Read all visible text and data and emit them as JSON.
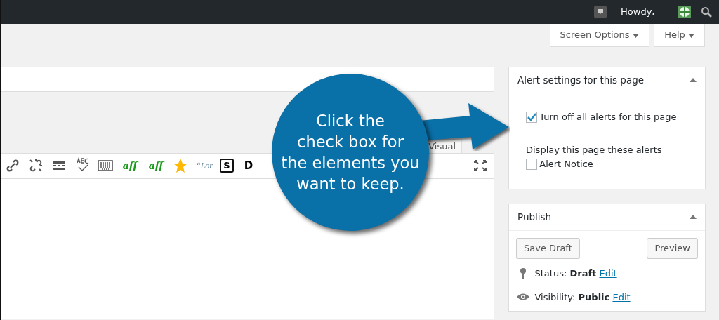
{
  "admin_bar": {
    "greeting": "Howdy,"
  },
  "header_buttons": [
    {
      "label": "Screen Options"
    },
    {
      "label": "Help"
    }
  ],
  "editor": {
    "tabs": [
      {
        "label": "Visual",
        "selected": true
      }
    ],
    "toolbar": [
      {
        "kind": "link"
      },
      {
        "kind": "unlink"
      },
      {
        "kind": "more"
      },
      {
        "kind": "spellcheck"
      },
      {
        "kind": "keyboard"
      },
      {
        "kind": "aff",
        "label": "aff"
      },
      {
        "kind": "aff-plus",
        "label": "aff"
      },
      {
        "kind": "star"
      },
      {
        "kind": "quote",
        "label": "“Lor"
      },
      {
        "kind": "boxed",
        "label": "S"
      },
      {
        "kind": "plain",
        "label": "D"
      }
    ]
  },
  "alert_box": {
    "title": "Alert settings for this page",
    "expanded": true,
    "options": [
      {
        "label": "Turn off all alerts for this page",
        "checked": true
      }
    ],
    "group_label": "Display this page these alerts",
    "alerts": [
      {
        "label": "Alert Notice",
        "checked": false
      }
    ]
  },
  "publish_box": {
    "title": "Publish",
    "expanded": true,
    "buttons": [
      {
        "label": "Save Draft"
      },
      {
        "label": "Preview"
      }
    ],
    "rows": [
      {
        "kind": "pin",
        "label": "Status:",
        "value": "Draft",
        "link": "Edit"
      },
      {
        "kind": "eye",
        "label": "Visibility:",
        "value": "Public",
        "link": "Edit"
      }
    ]
  },
  "callout": {
    "lines": [
      "Click the",
      "check box for",
      "the elements you",
      "want to keep."
    ]
  }
}
